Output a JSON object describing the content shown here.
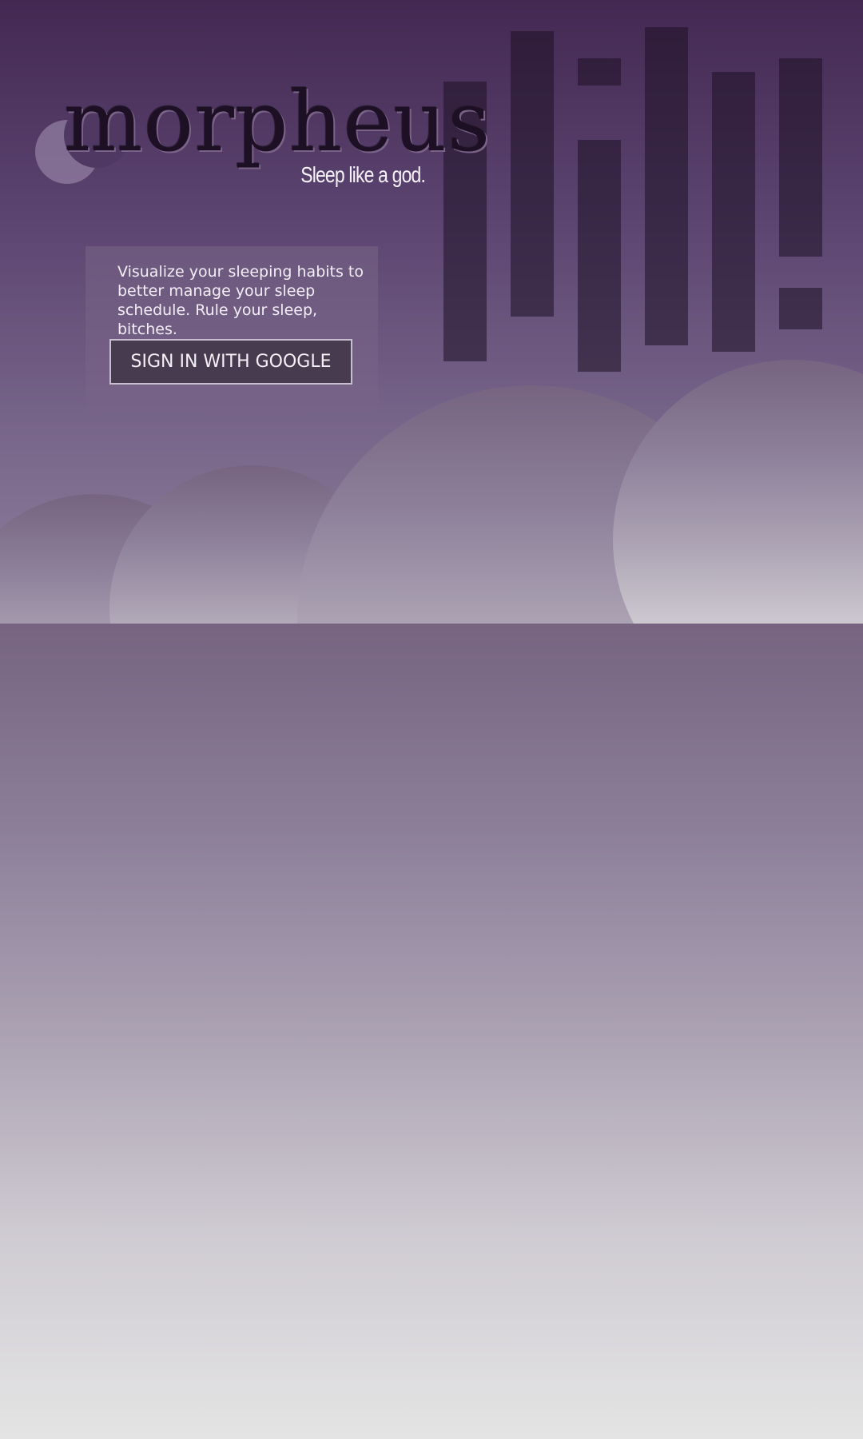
{
  "brand": {
    "name": "morpheus",
    "tagline": "Sleep like a god."
  },
  "intro": {
    "text": "Visualize your sleeping habits to better manage your sleep schedule. Rule your sleep, bitches.",
    "signin_label": "SIGN IN WITH GOOGLE"
  },
  "icons": {
    "logo": "crescent-moon-icon"
  },
  "colors": {
    "sky_top": "#432952",
    "sky_bottom": "#e4e4e4",
    "button_background": "#473b4f",
    "button_border": "#c7bfcf"
  }
}
